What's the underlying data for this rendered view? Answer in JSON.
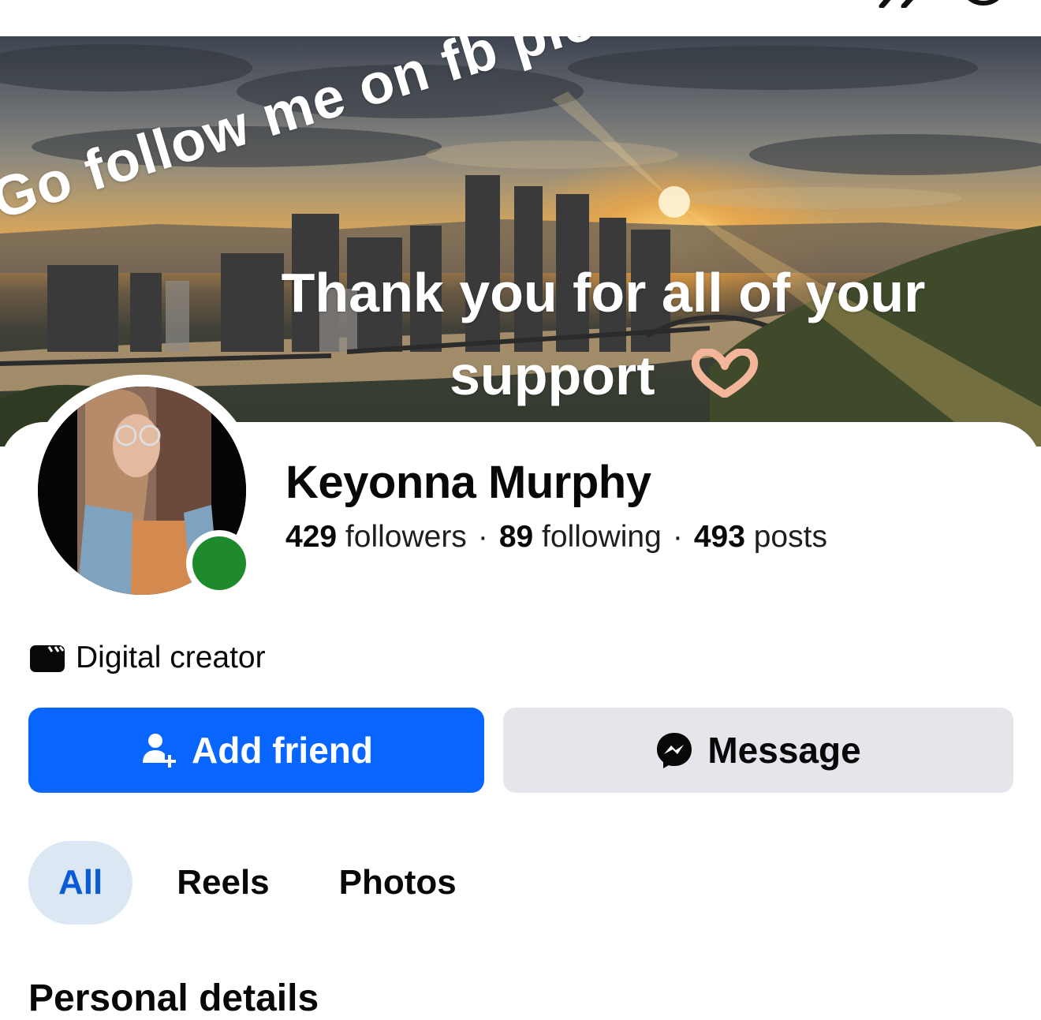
{
  "cover": {
    "story_text_diagonal": "Go follow me on fb please!!!",
    "story_text_line1": "Thank you for all of your",
    "story_text_line2": "support",
    "emoji": "heart-hands"
  },
  "profile": {
    "name": "Keyonna Murphy",
    "followers_count": "429",
    "followers_label": "followers",
    "following_count": "89",
    "following_label": "following",
    "posts_count": "493",
    "posts_label": "posts",
    "status": "online",
    "category_icon": "clapperboard-icon",
    "category": "Digital creator"
  },
  "actions": {
    "add_friend_label": "Add friend",
    "message_label": "Message"
  },
  "tabs": [
    {
      "label": "All",
      "active": true
    },
    {
      "label": "Reels",
      "active": false
    },
    {
      "label": "Photos",
      "active": false
    }
  ],
  "sections": {
    "personal_details_title": "Personal details"
  },
  "colors": {
    "primary_blue": "#0866ff",
    "secondary_gray": "#e4e6eb",
    "active_tab_bg": "#dbe7f2",
    "online_green": "#1f8a2b"
  }
}
